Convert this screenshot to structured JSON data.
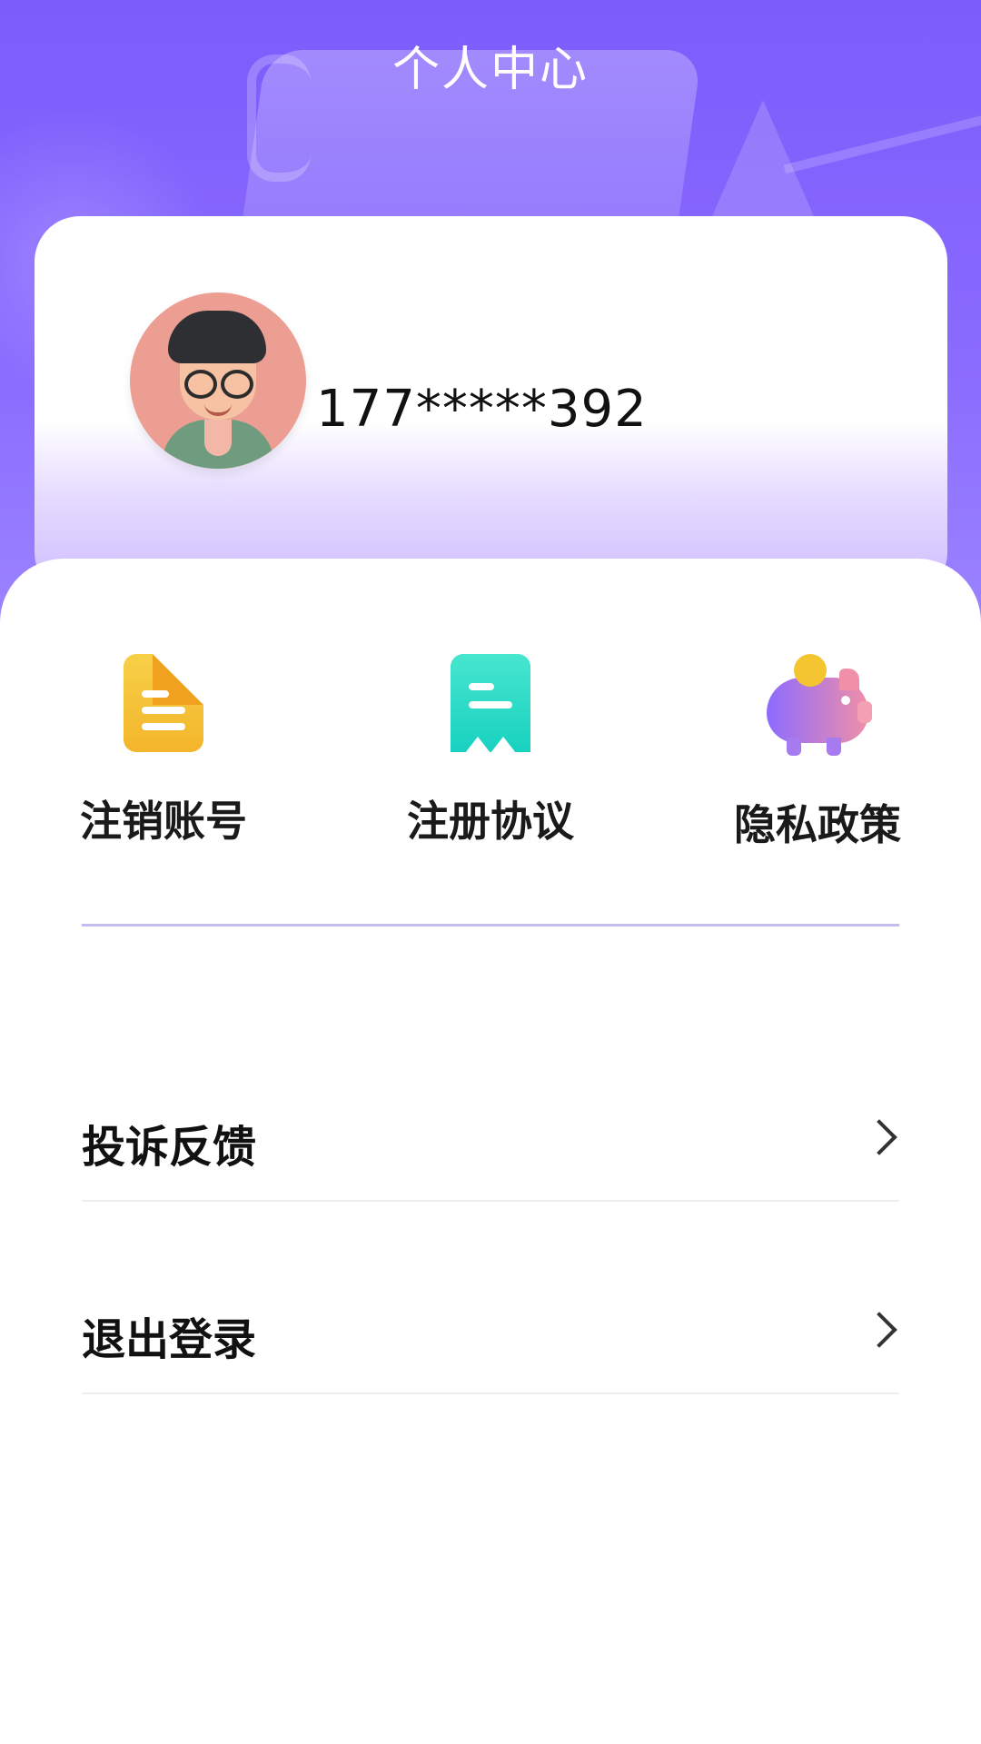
{
  "header": {
    "title": "个人中心"
  },
  "profile": {
    "phone_masked": "177*****392"
  },
  "quick_actions": [
    {
      "label": "注销账号",
      "icon": "document-icon"
    },
    {
      "label": "注册协议",
      "icon": "receipt-icon"
    },
    {
      "label": "隐私政策",
      "icon": "piggy-bank-icon"
    }
  ],
  "menu": [
    {
      "label": "投诉反馈"
    },
    {
      "label": "退出登录"
    }
  ],
  "colors": {
    "header_purple": "#7c5cfb",
    "accent_divider": "#c6bcef",
    "doc_icon_yellow": "#f3b52b",
    "receipt_icon_teal": "#18d1c0",
    "pig_gradient_start": "#8d6bff",
    "pig_gradient_end": "#f08fa8"
  }
}
